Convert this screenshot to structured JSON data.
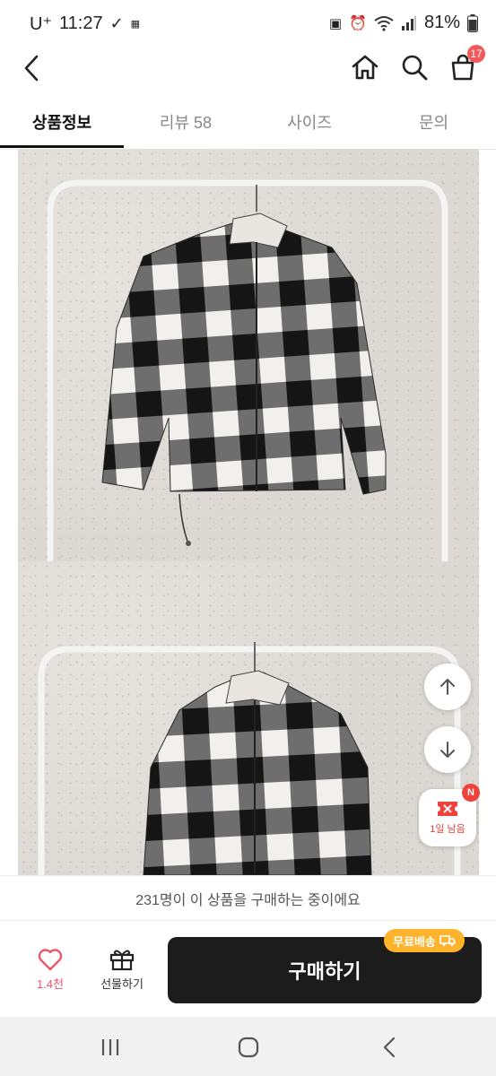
{
  "status_bar": {
    "carrier": "U⁺",
    "time": "11:27",
    "battery": "81%"
  },
  "header": {
    "back_icon": "chevron-left-icon",
    "home_icon": "home-icon",
    "search_icon": "search-icon",
    "cart_icon": "shopping-bag-icon",
    "cart_count": "17"
  },
  "tabs": [
    {
      "label": "상품정보",
      "active": true
    },
    {
      "label": "리뷰 58",
      "active": false
    },
    {
      "label": "사이즈",
      "active": false
    },
    {
      "label": "문의",
      "active": false
    }
  ],
  "floating": {
    "scroll_up_icon": "arrow-up-icon",
    "scroll_down_icon": "arrow-down-icon",
    "coupon_badge": "N",
    "coupon_label": "1일 남음"
  },
  "notice": "231명이 이 상품을 구매하는 중이에요",
  "actions": {
    "like_count": "1.4천",
    "gift_label": "선물하기",
    "buy_label": "구매하기",
    "free_shipping": "무료배송"
  },
  "colors": {
    "accent": "#f05a5a",
    "buy_button": "#1c1c1c",
    "free_shipping": "#ffb32a",
    "heart": "#e8586f"
  }
}
